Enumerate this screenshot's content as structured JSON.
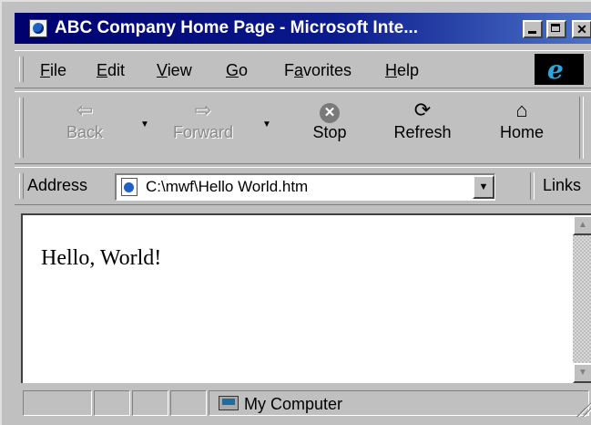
{
  "window": {
    "title": "ABC Company Home Page - Microsoft Inte..."
  },
  "menu": {
    "items": [
      {
        "pre": "",
        "key": "F",
        "post": "ile"
      },
      {
        "pre": "",
        "key": "E",
        "post": "dit"
      },
      {
        "pre": "",
        "key": "V",
        "post": "iew"
      },
      {
        "pre": "",
        "key": "G",
        "post": "o"
      },
      {
        "pre": "F",
        "key": "a",
        "post": "vorites"
      },
      {
        "pre": "",
        "key": "H",
        "post": "elp"
      }
    ]
  },
  "toolbar": {
    "back": "Back",
    "forward": "Forward",
    "stop": "Stop",
    "refresh": "Refresh",
    "home": "Home",
    "back_enabled": false,
    "forward_enabled": false
  },
  "address": {
    "label": "Address",
    "value": "C:\\mwf\\Hello World.htm",
    "links_label": "Links"
  },
  "content": {
    "text": "Hello, World!"
  },
  "status": {
    "zone": "My Computer"
  },
  "icons": {
    "title": "ie-page-icon",
    "logo": "ie-logo-icon",
    "back": "left-arrow-icon",
    "forward": "right-arrow-icon",
    "stop": "stop-icon",
    "refresh": "refresh-icon",
    "home": "home-icon",
    "zone": "computer-icon"
  },
  "colors": {
    "titlebar_start": "#00006e",
    "titlebar_end": "#4d73c8",
    "chrome": "#c0c0c0",
    "logo_accent": "#2aa6e0"
  }
}
